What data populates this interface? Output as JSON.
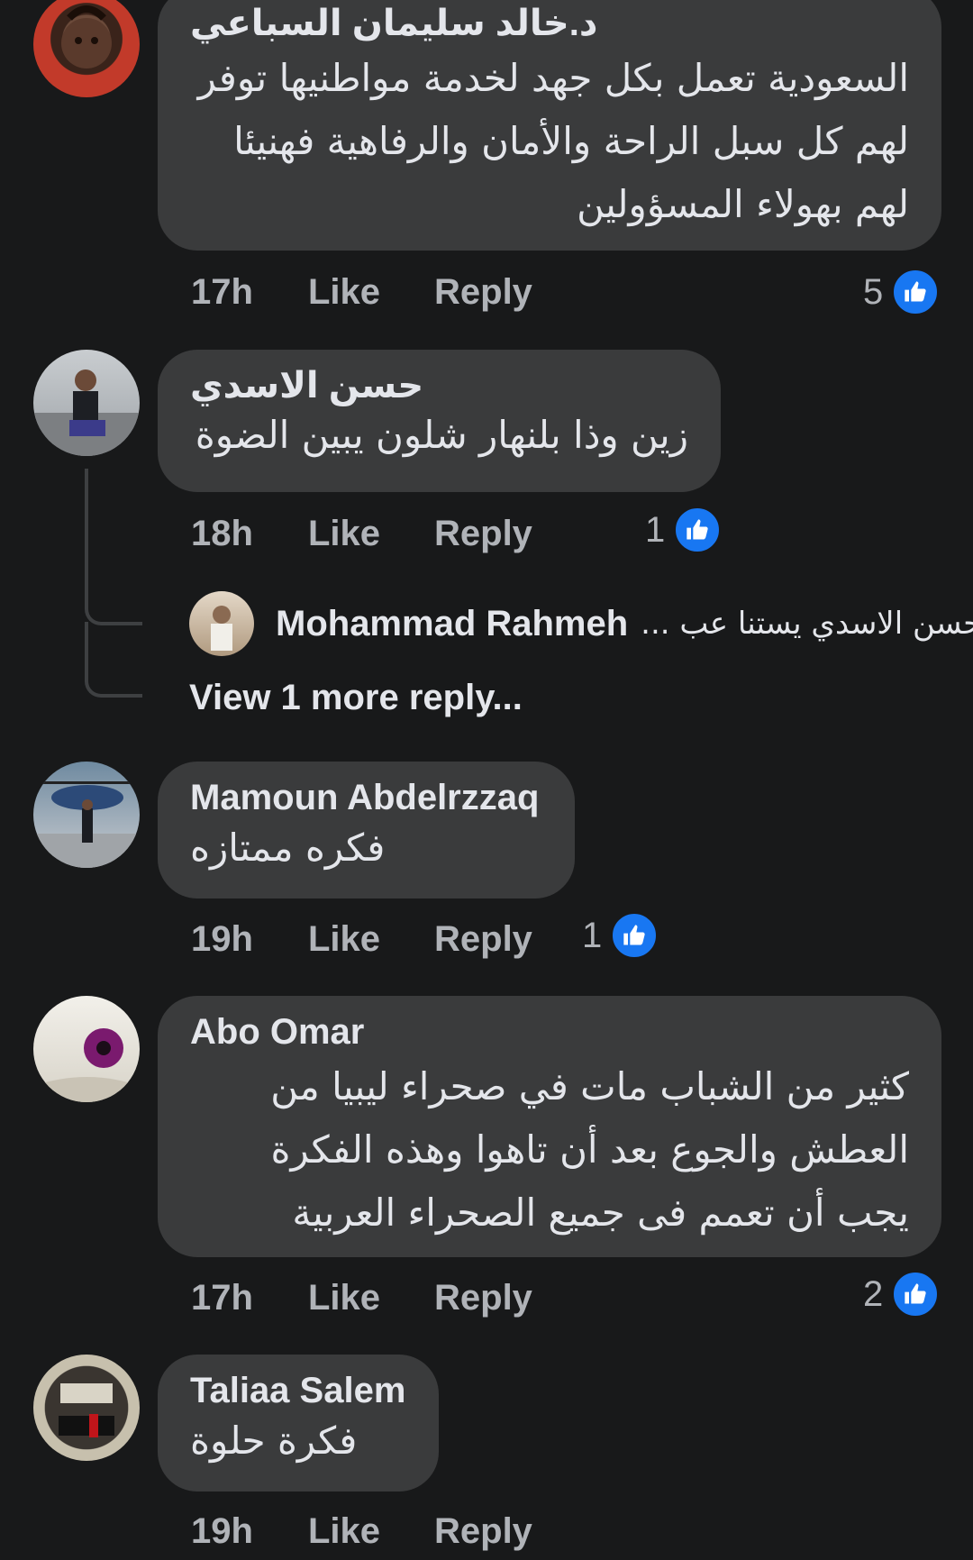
{
  "comments": [
    {
      "author": "د.خالد سليمان السباعي",
      "text": "السعودية تعمل بكل جهد لخدمة مواطنيها توفر لهم كل سبل الراحة والأمان والرفاهية فهنيئا لهم بهولاء المسؤولين",
      "time": "17h",
      "like": "Like",
      "reply": "Reply",
      "reactions": "5"
    },
    {
      "author": "حسن الاسدي",
      "text": "زين وذا بلنهار  شلون يبين الضوة",
      "time": "18h",
      "like": "Like",
      "reply": "Reply",
      "reactions": "1",
      "reply_preview": {
        "author": "Mohammad Rahmeh",
        "snippet": "حسن الاسدي يستنا عب ..."
      },
      "view_more": "View 1 more reply..."
    },
    {
      "author": "Mamoun Abdelrzzaq",
      "text": "فكره ممتازه",
      "time": "19h",
      "like": "Like",
      "reply": "Reply",
      "reactions": "1"
    },
    {
      "author": "Abo Omar",
      "text": "كثير من الشباب مات في صحراء ليبيا من العطش والجوع بعد أن تاهوا وهذه الفكرة يجب أن تعمم فى جميع الصحراء العربية",
      "time": "17h",
      "like": "Like",
      "reply": "Reply",
      "reactions": "2"
    },
    {
      "author": "Taliaa Salem",
      "text": "فكرة حلوة",
      "time": "19h",
      "like": "Like",
      "reply": "Reply"
    }
  ],
  "colors": {
    "background": "#18191a",
    "bubble": "#3a3b3c",
    "like_blue": "#1877f2",
    "meta_text": "#b0b3b8"
  },
  "icons": [
    "like-reaction-icon"
  ]
}
